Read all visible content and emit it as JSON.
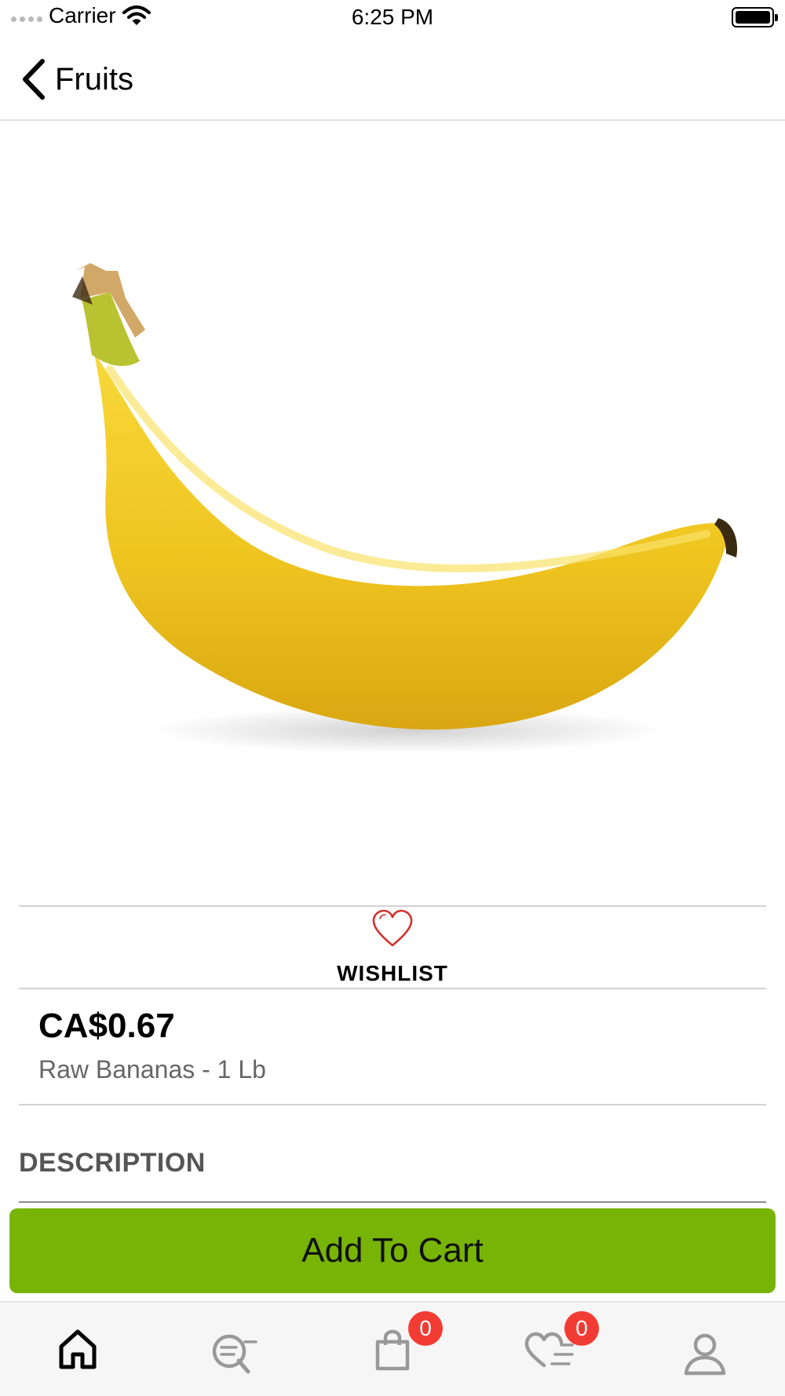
{
  "status_bar": {
    "carrier": "Carrier",
    "time": "6:25 PM"
  },
  "nav": {
    "back_icon": "chevron-left-icon",
    "title": "Fruits"
  },
  "product": {
    "image": "banana",
    "wishlist_label": "WISHLIST",
    "wishlist_icon": "heart-outline-icon",
    "price": "CA$0.67",
    "name": "Raw Bananas - 1 Lb",
    "description_heading": "DESCRIPTION"
  },
  "actions": {
    "add_to_cart": "Add To Cart",
    "accent_color": "#78b406"
  },
  "tab_bar": {
    "tabs": [
      {
        "name": "home",
        "icon": "home-icon",
        "active": true
      },
      {
        "name": "search",
        "icon": "search-icon",
        "active": false
      },
      {
        "name": "cart",
        "icon": "shopping-bag-icon",
        "badge": "0",
        "active": false
      },
      {
        "name": "wishlist",
        "icon": "heart-list-icon",
        "badge": "0",
        "active": false
      },
      {
        "name": "profile",
        "icon": "user-icon",
        "active": false
      }
    ],
    "badge_color": "#f23c33"
  }
}
